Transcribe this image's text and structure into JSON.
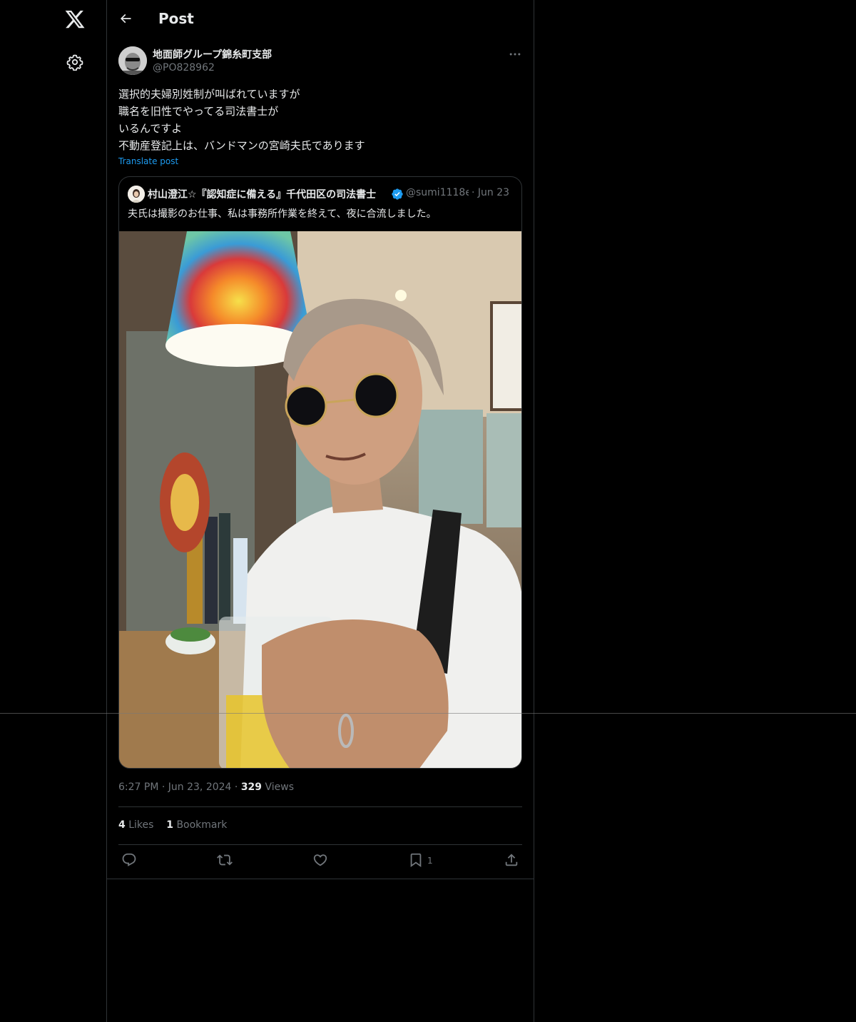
{
  "header": {
    "title": "Post",
    "back_label": ""
  },
  "post": {
    "author_name": "地面師グループ錦糸町支部",
    "author_handle": "@PO828962",
    "lines": [
      "選択的夫婦別姓制が叫ばれていますが",
      "職名を旧性でやってる司法書士が",
      "いるんですよ",
      "不動産登記上は、バンドマンの宮崎夫氏であります"
    ],
    "translate_label": "Translate post"
  },
  "quote": {
    "name": "村山澄江☆『認知症に備える』千代田区の司法書士",
    "handle": "@sumi1118e",
    "sep": "·",
    "date": "Jun 23",
    "text": "夫氏は撮影のお仕事、私は事務所作業を終えて、夜に合流しました。"
  },
  "meta": {
    "time": "6:27 PM",
    "sep": "·",
    "date": "Jun 23, 2024",
    "views_count": "329",
    "views_label": "Views"
  },
  "stats": {
    "likes_count": "4",
    "likes_label": "Likes",
    "bookmarks_count": "1",
    "bookmarks_label": "Bookmark"
  },
  "actions": {
    "bookmark_count": "1"
  },
  "icons": [
    "x-logo-icon",
    "gear-icon",
    "back-arrow-icon",
    "more-icon",
    "verified-badge-icon",
    "reply-icon",
    "retweet-icon",
    "like-icon",
    "bookmark-icon",
    "share-icon"
  ],
  "colors": {
    "background": "#000000",
    "text": "#e7e9ea",
    "muted": "#71767b",
    "link": "#1d9bf0",
    "border": "#2f3336"
  }
}
